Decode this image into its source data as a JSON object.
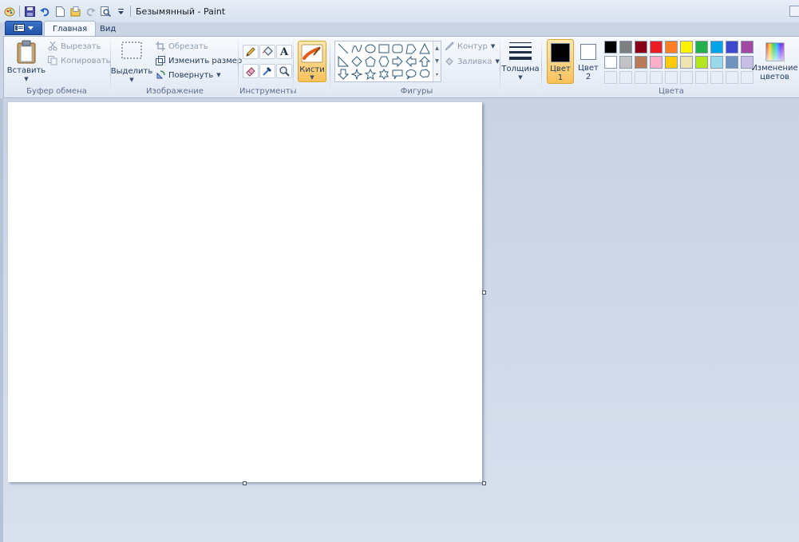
{
  "window": {
    "title": "Безымянный - Paint"
  },
  "tabs": [
    {
      "label": "Главная",
      "active": true
    },
    {
      "label": "Вид",
      "active": false
    }
  ],
  "clipboard": {
    "paste_label": "Вставить",
    "cut_label": "Вырезать",
    "copy_label": "Копировать",
    "group_label": "Буфер обмена"
  },
  "image": {
    "select_label": "Выделить",
    "crop_label": "Обрезать",
    "resize_label": "Изменить размер",
    "rotate_label": "Повернуть",
    "group_label": "Изображение"
  },
  "tools": {
    "items": [
      "pencil-icon",
      "fill-icon",
      "text-icon",
      "eraser-icon",
      "color-picker-icon",
      "magnifier-icon"
    ],
    "text_glyph": "A",
    "group_label": "Инструменты"
  },
  "brushes": {
    "label": "Кисти"
  },
  "shapes": {
    "outline_label": "Контур",
    "fill_label": "Заливка",
    "group_label": "Фигуры"
  },
  "size": {
    "label": "Толщина"
  },
  "colors": {
    "color1_label": "Цвет",
    "color1_num": "1",
    "color2_label": "Цвет",
    "color2_num": "2",
    "edit_label_line1": "Изменение",
    "edit_label_line2": "цветов",
    "group_label": "Цвета",
    "color1_value": "#000000",
    "color2_value": "#ffffff",
    "row1": [
      "#000000",
      "#7f7f7f",
      "#880015",
      "#ed1c24",
      "#ff7f27",
      "#fff200",
      "#22b14c",
      "#00a2e8",
      "#3f48cc",
      "#a349a4"
    ],
    "row2": [
      "#ffffff",
      "#c3c3c3",
      "#b97a57",
      "#ffaec9",
      "#ffc90e",
      "#efe4b0",
      "#b5e61d",
      "#99d9ea",
      "#7092be",
      "#c8bfe7"
    ]
  }
}
